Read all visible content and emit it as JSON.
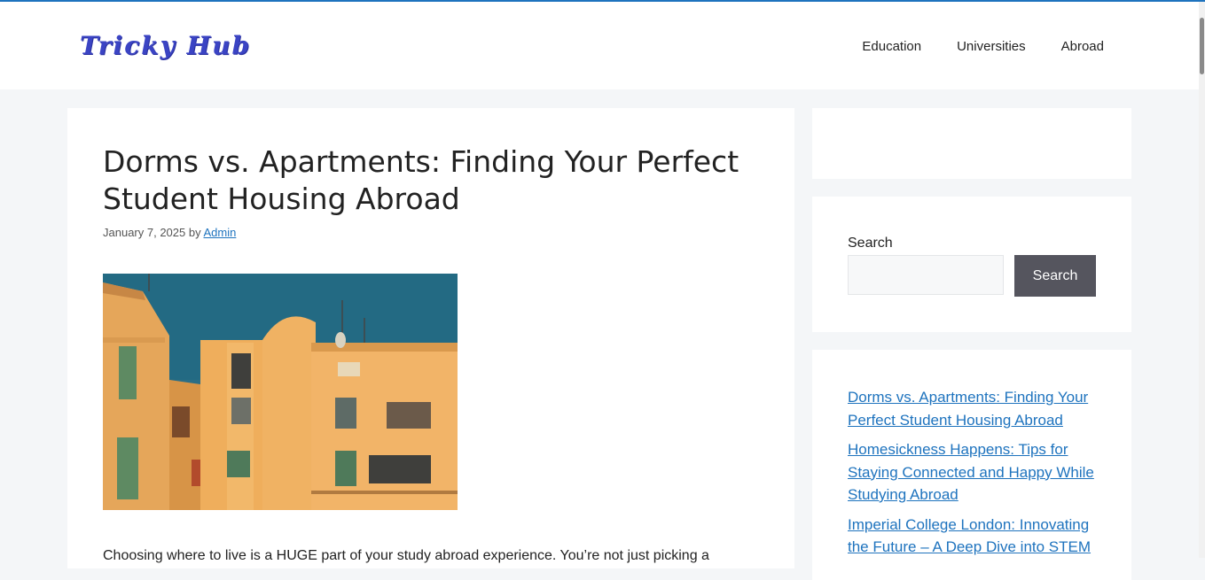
{
  "site": {
    "logo": "Tricky Hub",
    "nav": [
      "Education",
      "Universities",
      "Abroad"
    ]
  },
  "article": {
    "title": "Dorms vs. Apartments: Finding Your Perfect Student Housing Abroad",
    "date": "January 7, 2025",
    "by": "by",
    "author": "Admin",
    "excerpt": "Choosing where to live is a HUGE part of your study abroad experience. You’re not just picking a"
  },
  "sidebar": {
    "search_label": "Search",
    "search_button": "Search",
    "recent_posts": [
      "Dorms vs. Apartments: Finding Your Perfect Student Housing Abroad",
      "Homesickness Happens: Tips for Staying Connected and Happy While Studying Abroad",
      "Imperial College London: Innovating the Future – A Deep Dive into STEM"
    ]
  },
  "colors": {
    "accent": "#1e73be",
    "logo": "#3b44c4",
    "button": "#55555e",
    "background": "#f4f6f8"
  }
}
